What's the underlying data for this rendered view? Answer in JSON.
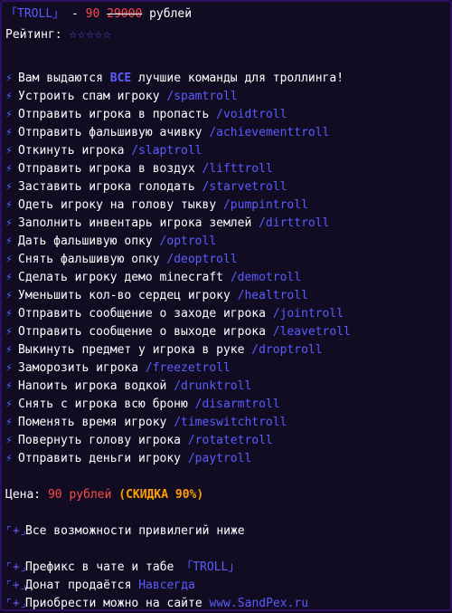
{
  "header": {
    "bracket_open": "「",
    "name": "TROLL",
    "bracket_close": "」",
    "dash": " - ",
    "price_new": "90",
    "price_old": "29000",
    "currency": "рублей"
  },
  "rating": {
    "label": "Рейтинг:",
    "stars": "☆☆☆☆☆",
    "stars_filled": 0,
    "stars_total": 5
  },
  "bolt_icon": "⚡",
  "intro": {
    "before": "Вам выдаются ",
    "highlight": "ВСЕ",
    "after": " лучшие команды для троллинга!"
  },
  "commands": [
    {
      "text": "Устроить спам игроку ",
      "cmd": "/spamtroll"
    },
    {
      "text": "Отправить игрока в пропасть ",
      "cmd": "/voidtroll"
    },
    {
      "text": "Отправить фальшивую ачивку ",
      "cmd": "/achievementtroll"
    },
    {
      "text": "Откинуть игрока ",
      "cmd": "/slaptroll"
    },
    {
      "text": "Отправить игрока в воздух ",
      "cmd": "/lifttroll"
    },
    {
      "text": "Заставить игрока голодать ",
      "cmd": "/starvetroll"
    },
    {
      "text": "Одеть игроку на голову тыкву ",
      "cmd": "/pumpintroll"
    },
    {
      "text": "Заполнить инвентарь игрока землей ",
      "cmd": "/dirttroll"
    },
    {
      "text": "Дать фальшивую опку ",
      "cmd": "/optroll"
    },
    {
      "text": "Снять фальшивую опку ",
      "cmd": "/deoptroll"
    },
    {
      "text": "Сделать игроку демо minecraft ",
      "cmd": "/demotroll"
    },
    {
      "text": "Уменьшить кол-во сердец игроку ",
      "cmd": "/healtroll"
    },
    {
      "text": "Отправить сообщение о заходе игрока ",
      "cmd": "/jointroll"
    },
    {
      "text": "Отправить сообщение о выходе игрока ",
      "cmd": "/leavetroll"
    },
    {
      "text": "Выкинуть предмет у игрока в руке ",
      "cmd": "/droptroll"
    },
    {
      "text": "Заморозить игрока ",
      "cmd": "/freezetroll"
    },
    {
      "text": "Напоить игрока водкой ",
      "cmd": "/drunktroll"
    },
    {
      "text": "Снять с игрока всю броню ",
      "cmd": "/disarmtroll"
    },
    {
      "text": "Поменять время игроку ",
      "cmd": "/timeswitchtroll"
    },
    {
      "text": "Повернуть голову игрока ",
      "cmd": "/rotatetroll"
    },
    {
      "text": "Отправить деньги игроку ",
      "cmd": "/paytroll"
    }
  ],
  "price": {
    "label": "Цена: ",
    "value": "90 рублей",
    "discount": "(СКИДКА 90%)"
  },
  "plus_icon": "⌜+⌟",
  "features_header": "Все возможности привилегий ниже",
  "features": {
    "prefix": {
      "text": "Префикс в чате и табе ",
      "value": "「TROLL」"
    },
    "sold": {
      "text": "Донат продаётся ",
      "value": "Навсегда"
    },
    "buy": {
      "text": "Приобрести можно на сайте ",
      "value": "www.SandPex.ru"
    }
  },
  "colors": {
    "accent": "#5a5cff",
    "price": "#ff4a4a",
    "discount": "#ffa000",
    "background": "#120c22",
    "border": "#2a0f63"
  }
}
